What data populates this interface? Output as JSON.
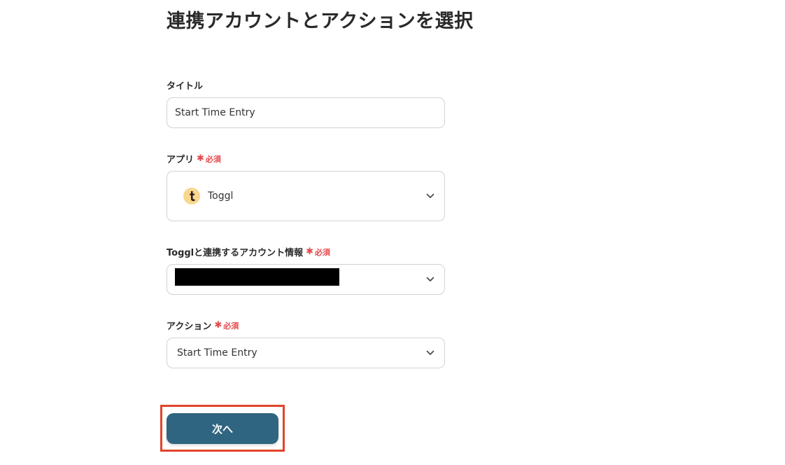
{
  "page": {
    "title": "連携アカウントとアクションを選択"
  },
  "required_text": "必須",
  "required_mark": "✱",
  "fields": {
    "title": {
      "label": "タイトル",
      "value": "Start Time Entry"
    },
    "app": {
      "label": "アプリ",
      "value": "Toggl",
      "logo_letter": "t",
      "logo_bg": "#f8d78e",
      "icon": "chevron-down-icon"
    },
    "account": {
      "label": "Togglと連携するアカウント情報",
      "value_redacted": true,
      "icon": "chevron-down-icon"
    },
    "action": {
      "label": "アクション",
      "value": "Start Time Entry",
      "icon": "chevron-down-icon"
    }
  },
  "next_button": {
    "label": "次へ",
    "bg_color": "#2f6580",
    "highlight_color": "#e0452a"
  }
}
